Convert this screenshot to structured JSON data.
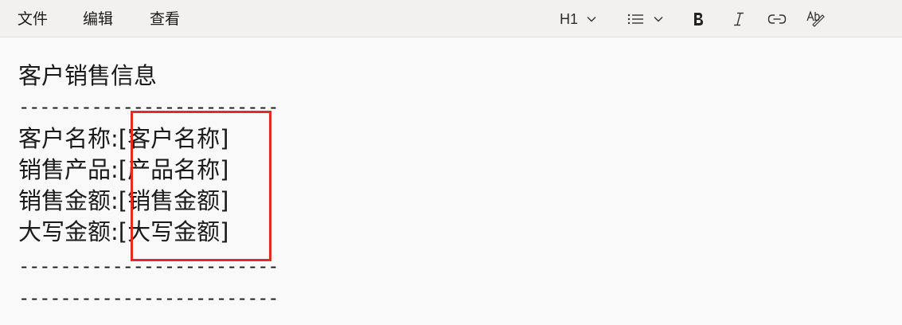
{
  "menu": {
    "file": "文件",
    "edit": "编辑",
    "view": "查看"
  },
  "toolbar": {
    "heading": "H1",
    "icons": [
      "chevron-down-icon",
      "list-icon",
      "bold-icon",
      "italic-icon",
      "link-icon",
      "spellcheck-icon"
    ]
  },
  "document": {
    "title": "客户销售信息",
    "separator": "-------------------------",
    "rows": [
      {
        "label": "客户名称:",
        "value": "[客户名称]"
      },
      {
        "label": "销售产品:",
        "value": "[产品名称]"
      },
      {
        "label": "销售金额:",
        "value": "[销售金额]"
      },
      {
        "label": "大写金额:",
        "value": "[大写金额]"
      }
    ]
  },
  "colors": {
    "highlight": "#e02b28",
    "menubar": "#f3f1f0",
    "background": "#f9f9f9"
  }
}
